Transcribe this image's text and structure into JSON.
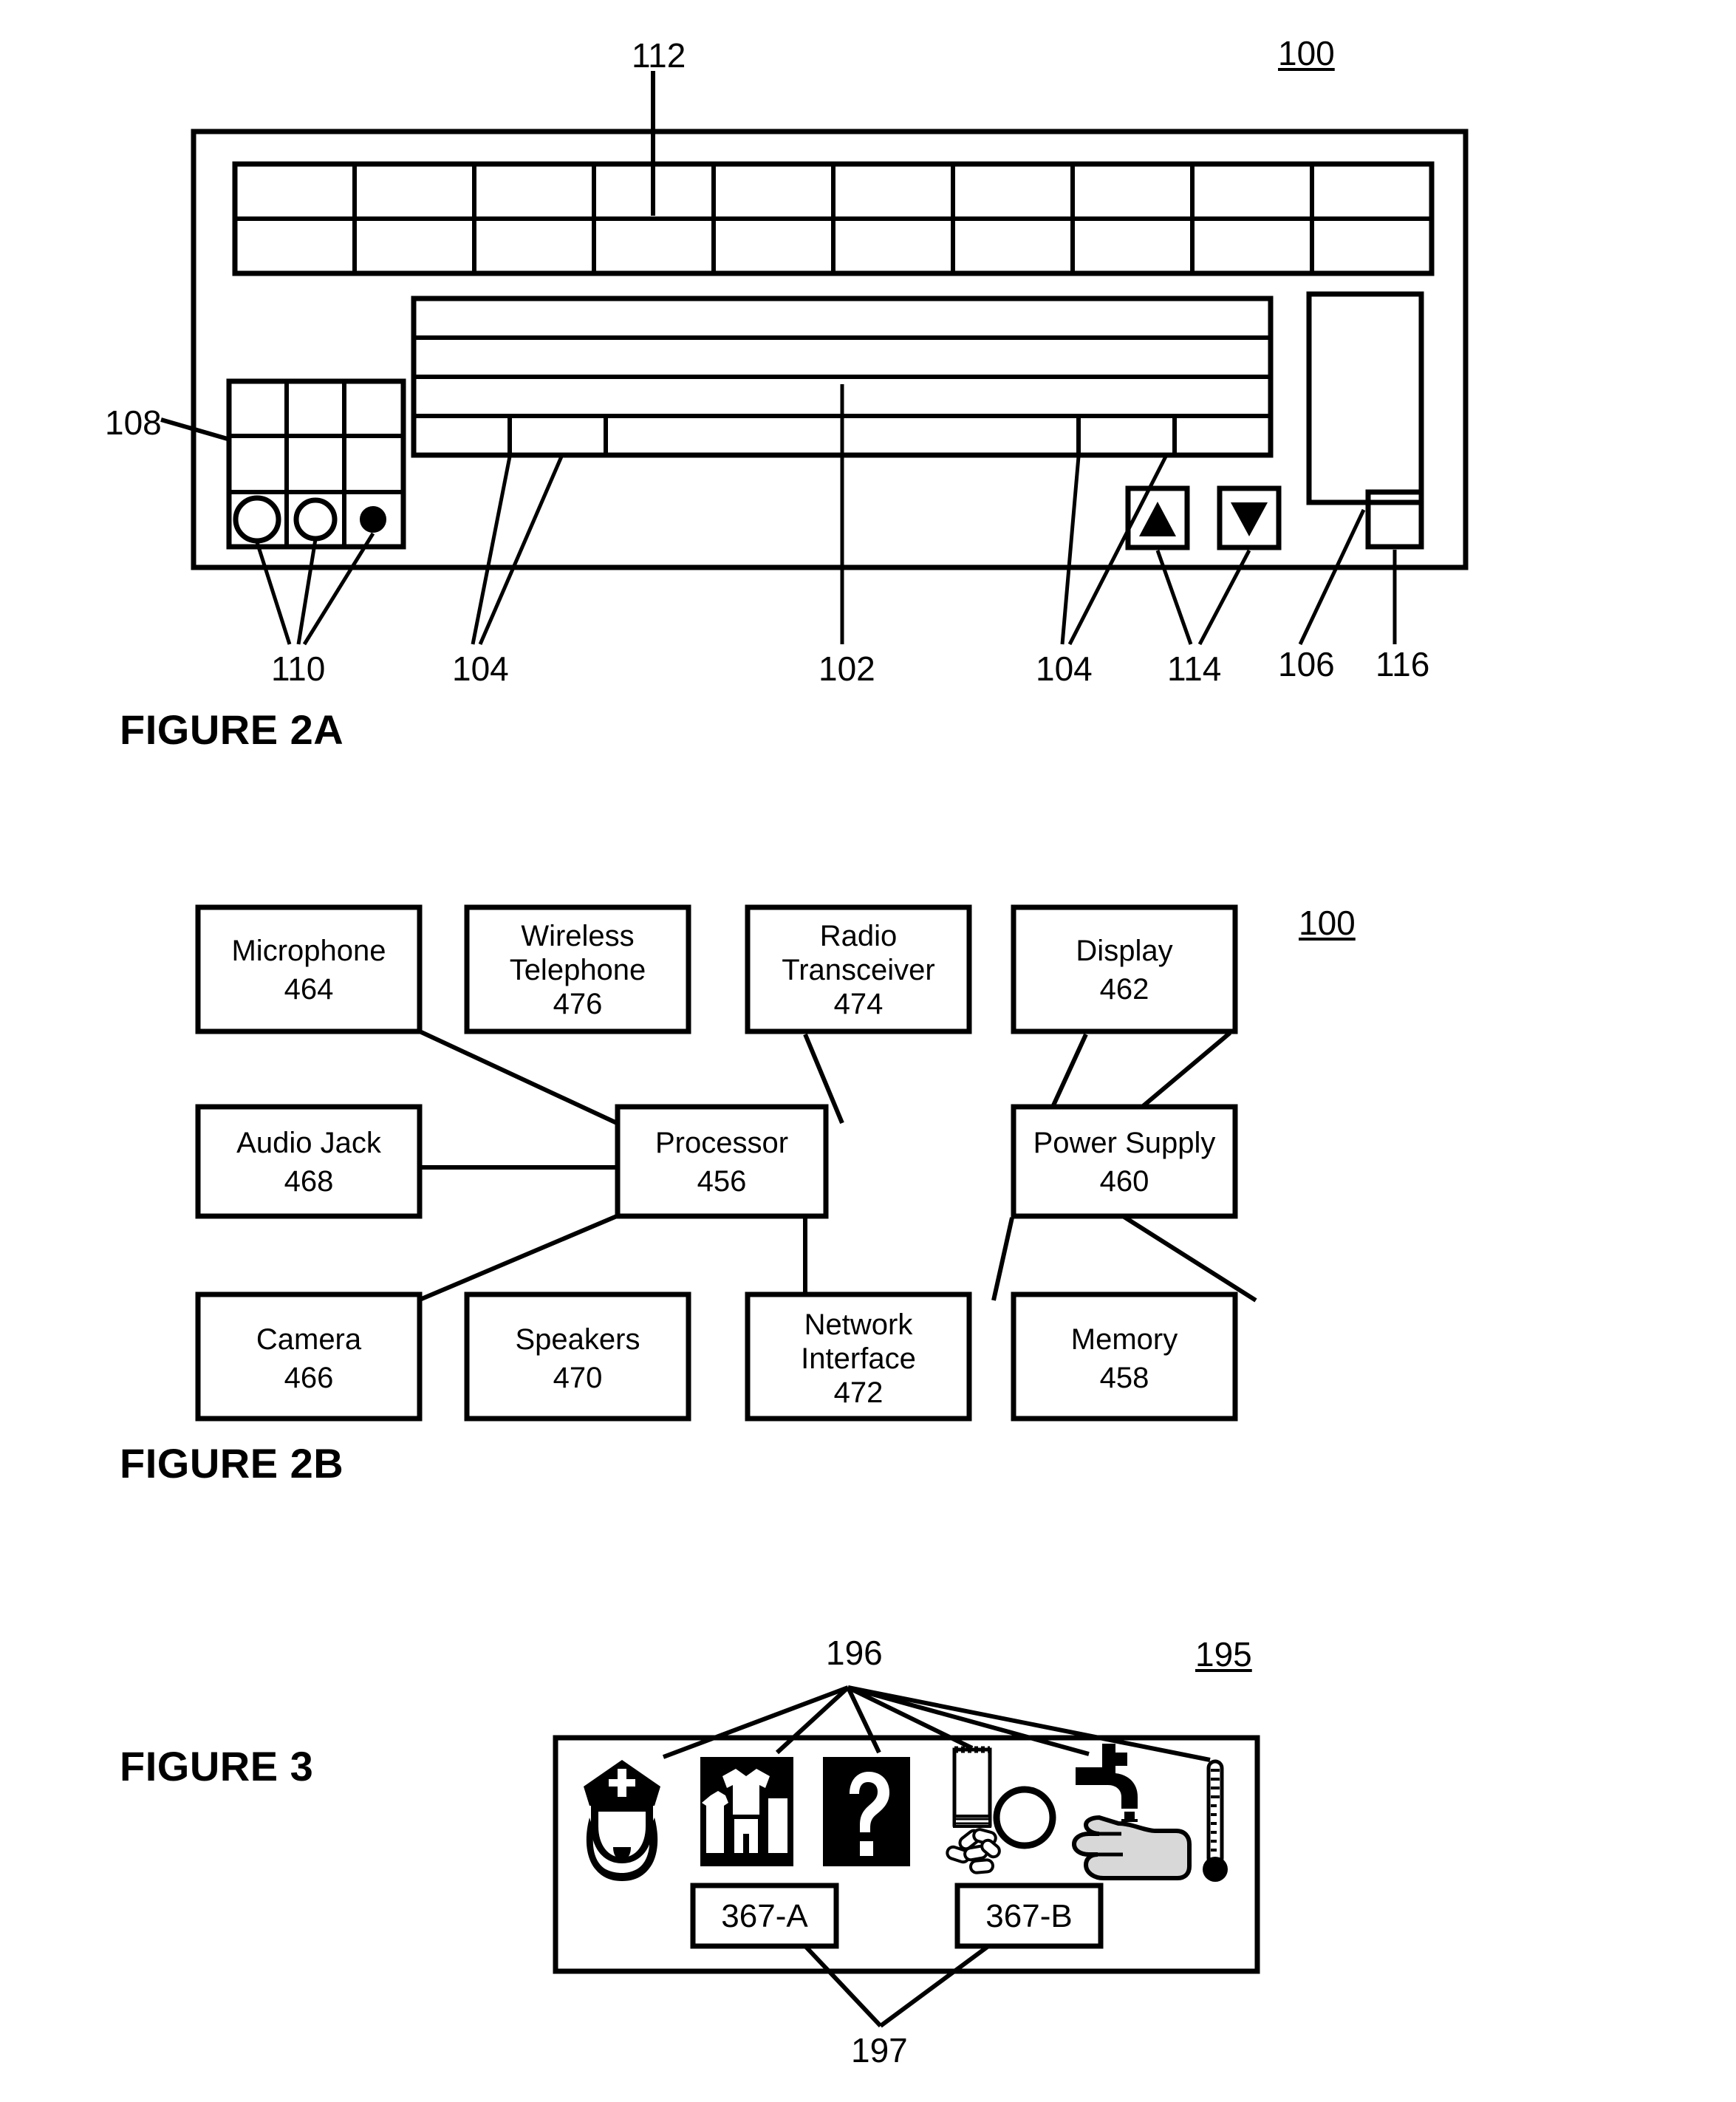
{
  "figures": [
    {
      "id": "figure-2a",
      "label": "FIGURE 2A",
      "assembly_ref": "100",
      "callouts": [
        {
          "ref": "112",
          "name": "display-row-callout"
        },
        {
          "ref": "108",
          "name": "function-pad-callout"
        },
        {
          "ref": "110",
          "name": "indicator-lights-callout"
        },
        {
          "ref": "104",
          "name": "left-key-callout"
        },
        {
          "ref": "102",
          "name": "keypad-callout"
        },
        {
          "ref": "104",
          "name": "right-key-callout"
        },
        {
          "ref": "114",
          "name": "scroll-buttons-callout"
        },
        {
          "ref": "106",
          "name": "side-panel-callout"
        },
        {
          "ref": "116",
          "name": "small-button-callout"
        }
      ],
      "arrow_buttons": {
        "up": "▲",
        "down": "▼"
      }
    },
    {
      "id": "figure-2b",
      "label": "FIGURE 2B",
      "assembly_ref": "100",
      "blocks": [
        {
          "name": "microphone",
          "title": "Microphone",
          "ref": "464"
        },
        {
          "name": "wireless-telephone",
          "title": "Wireless\nTelephone",
          "ref": "476"
        },
        {
          "name": "radio-transceiver",
          "title": "Radio\nTransceiver",
          "ref": "474"
        },
        {
          "name": "display",
          "title": "Display",
          "ref": "462"
        },
        {
          "name": "audio-jack",
          "title": "Audio Jack",
          "ref": "468"
        },
        {
          "name": "processor",
          "title": "Processor",
          "ref": "456"
        },
        {
          "name": "power-supply",
          "title": "Power Supply",
          "ref": "460"
        },
        {
          "name": "camera",
          "title": "Camera",
          "ref": "466"
        },
        {
          "name": "speakers",
          "title": "Speakers",
          "ref": "470"
        },
        {
          "name": "network-interface",
          "title": "Network\nInterface",
          "ref": "472"
        },
        {
          "name": "memory",
          "title": "Memory",
          "ref": "458"
        }
      ]
    },
    {
      "id": "figure-3",
      "label": "FIGURE 3",
      "assembly_ref": "195",
      "icon_group_ref": "196",
      "tag_group_ref": "197",
      "icons": [
        {
          "name": "nurse-icon",
          "description": "nurse"
        },
        {
          "name": "laundry-clothing-icon",
          "description": "clothing"
        },
        {
          "name": "question-mark-icon",
          "description": "question"
        },
        {
          "name": "medication-packet-icon",
          "description": "medication"
        },
        {
          "name": "pill-circle-icon",
          "description": "pill"
        },
        {
          "name": "handwashing-faucet-icon",
          "description": "handwashing"
        },
        {
          "name": "thermometer-icon",
          "description": "thermometer"
        }
      ],
      "tags": [
        {
          "name": "tag-367-a",
          "label": "367-A"
        },
        {
          "name": "tag-367-b",
          "label": "367-B"
        }
      ]
    }
  ],
  "colors": {
    "ink": "#000000",
    "paper": "#ffffff"
  }
}
